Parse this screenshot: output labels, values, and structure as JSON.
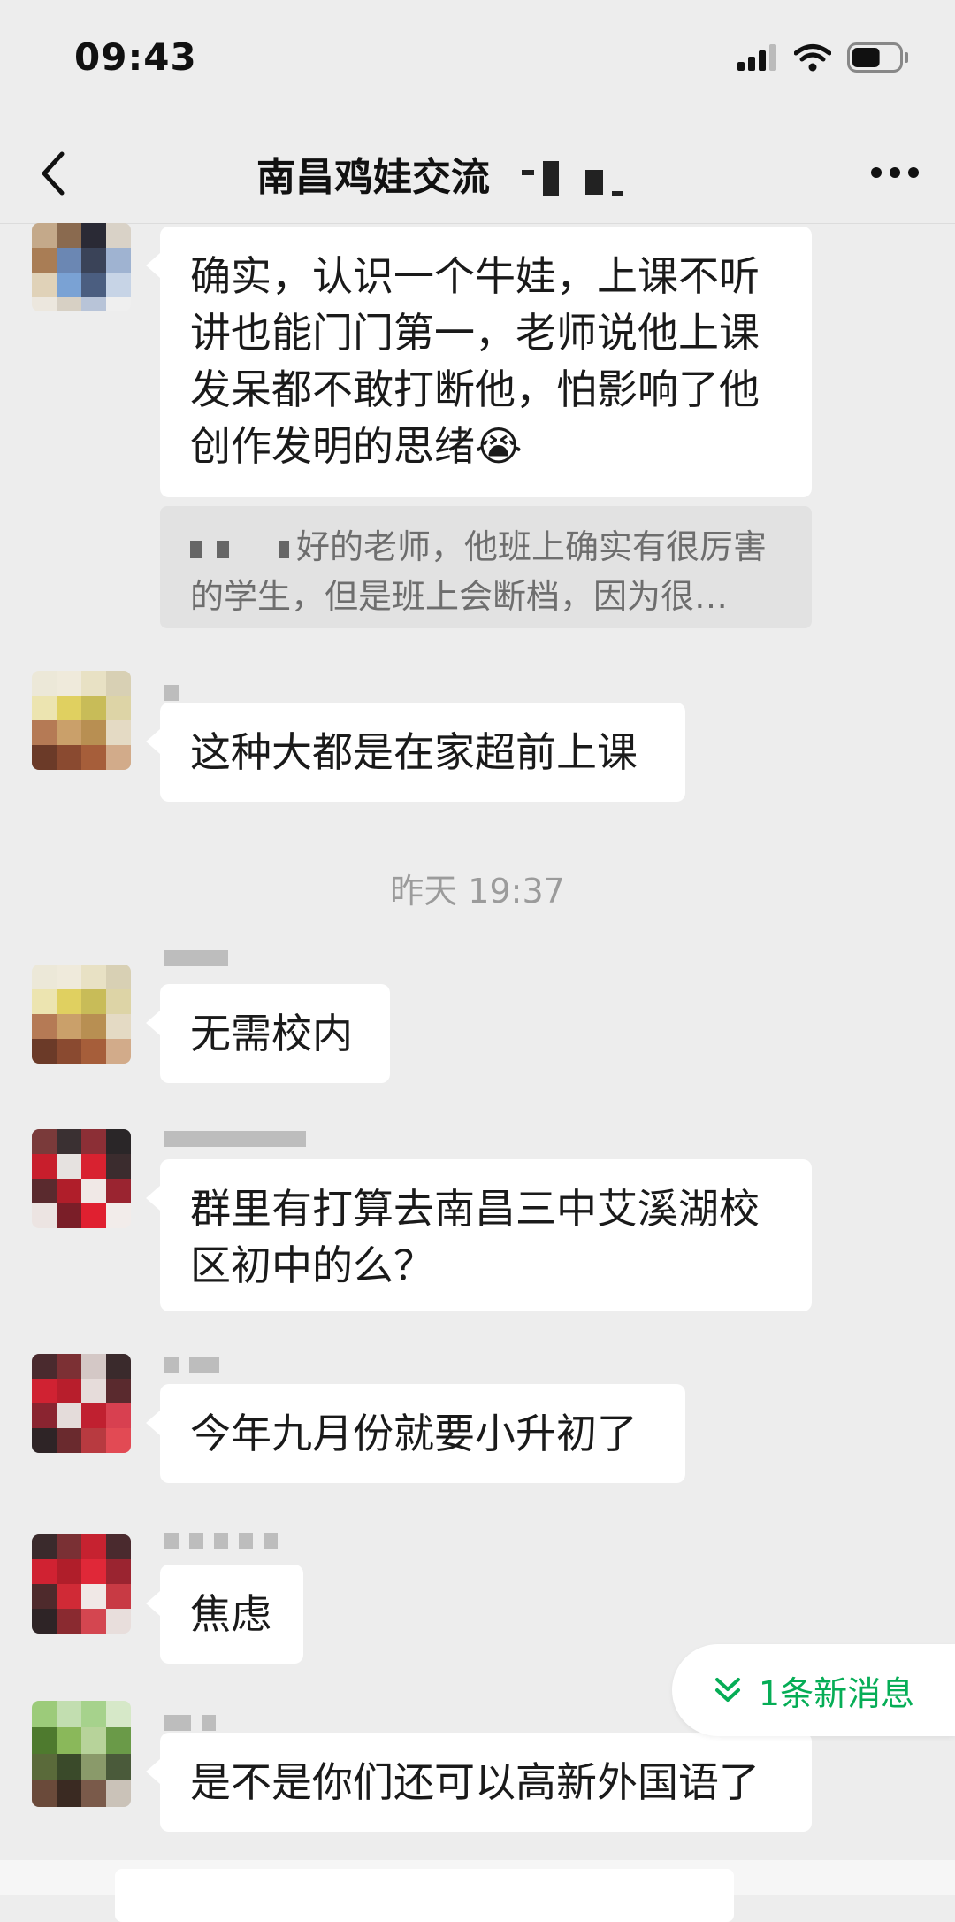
{
  "status_bar": {
    "time": "09:43",
    "battery_level": 0.6
  },
  "header": {
    "title": "南昌鸡娃交流"
  },
  "messages": [
    {
      "text": "确实，认识一个牛娃，上课不听讲也能门门第一，老师说他上课发呆都不敢打断他，怕影响了他创作发明的思绪",
      "emoji": "😭"
    },
    {
      "quote": "好的老师，他班上确实有很厉害的学生，但是班上会断档，因为很…"
    },
    {
      "text": "这种大都是在家超前上课"
    },
    {
      "text": "无需校内"
    },
    {
      "text": "群里有打算去南昌三中艾溪湖校区初中的么？"
    },
    {
      "text": "今年九月份就要小升初了"
    },
    {
      "text": "焦虑"
    },
    {
      "text": "是不是你们还可以高新外国语了"
    }
  ],
  "timestamp": "昨天 19:37",
  "new_message_pill": {
    "label": "1条新消息"
  },
  "colors": {
    "background": "#ededed",
    "bubble": "#ffffff",
    "accent": "#06ad56"
  },
  "icons": [
    "back-icon",
    "more-icon",
    "signal-icon",
    "wifi-icon",
    "battery-icon",
    "double-chevron-down-icon"
  ]
}
